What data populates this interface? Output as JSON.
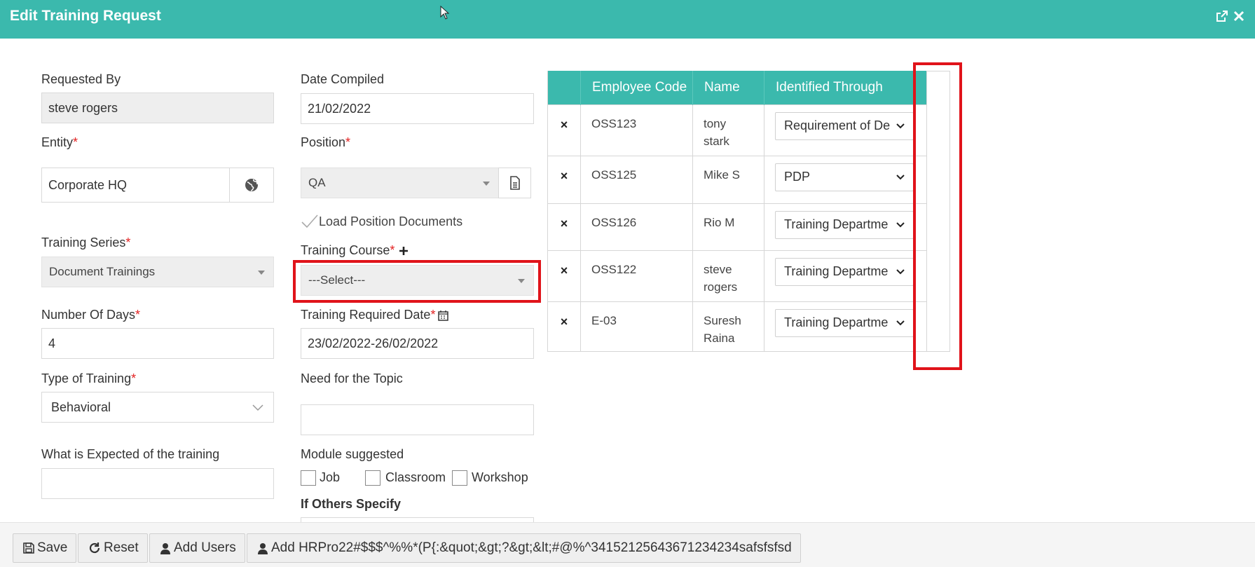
{
  "window": {
    "title": "Edit Training Request",
    "popout_icon": "external-link-icon",
    "close_icon": "close-icon"
  },
  "form": {
    "requested_by": {
      "label": "Requested By",
      "value": "steve rogers"
    },
    "date_compiled": {
      "label": "Date Compiled",
      "value": "21/02/2022"
    },
    "entity": {
      "label": "Entity",
      "required_mark": "*",
      "value": "Corporate HQ"
    },
    "position": {
      "label": "Position",
      "required_mark": "*",
      "value": "QA"
    },
    "load_position_documents": {
      "label": "Load Position Documents"
    },
    "training_series": {
      "label": "Training Series",
      "required_mark": "*",
      "value": "Document Trainings"
    },
    "training_course": {
      "label": "Training Course",
      "required_mark": "*",
      "value": "---Select---"
    },
    "number_of_days": {
      "label": "Number Of Days",
      "required_mark": "*",
      "value": "4"
    },
    "training_required_date": {
      "label": "Training Required Date",
      "required_mark": "*",
      "value": "23/02/2022-26/02/2022"
    },
    "type_of_training": {
      "label": "Type of Training",
      "required_mark": "*",
      "value": "Behavioral"
    },
    "need_for_topic": {
      "label": "Need for the Topic",
      "value": ""
    },
    "expected": {
      "label": "What is Expected of the training",
      "value": ""
    },
    "module_suggested": {
      "label": "Module suggested",
      "options": [
        {
          "label": "Job",
          "checked": false
        },
        {
          "label": "Classroom",
          "checked": false
        },
        {
          "label": "Workshop",
          "checked": false
        }
      ]
    },
    "if_others": {
      "label": "If Others Specify"
    }
  },
  "employees": {
    "columns": [
      "",
      "Employee Code",
      "Name",
      "Identified Through"
    ],
    "rows": [
      {
        "remove": "×",
        "code": "OSS123",
        "name_line1": "tony",
        "name_line2": "stark",
        "identified": "Requirement of De"
      },
      {
        "remove": "×",
        "code": "OSS125",
        "name_line1": "Mike S",
        "name_line2": "",
        "identified": "PDP"
      },
      {
        "remove": "×",
        "code": "OSS126",
        "name_line1": "Rio M",
        "name_line2": "",
        "identified": "Training Departme"
      },
      {
        "remove": "×",
        "code": "OSS122",
        "name_line1": "steve",
        "name_line2": "rogers",
        "identified": "Training Departme"
      },
      {
        "remove": "×",
        "code": "E-03",
        "name_line1": "Suresh",
        "name_line2": "Raina",
        "identified": "Training Departme"
      }
    ]
  },
  "footer": {
    "save": "Save",
    "reset": "Reset",
    "add_users": "Add Users",
    "add_hrpro": "Add HRPro22#$$$^%%*(P{:&quot;&gt;?&gt;&lt;#@%^34152125643671234234safsfsfsd"
  },
  "colors": {
    "header": "#3bb9ad",
    "required": "#e32222",
    "highlight": "#e0131a"
  }
}
